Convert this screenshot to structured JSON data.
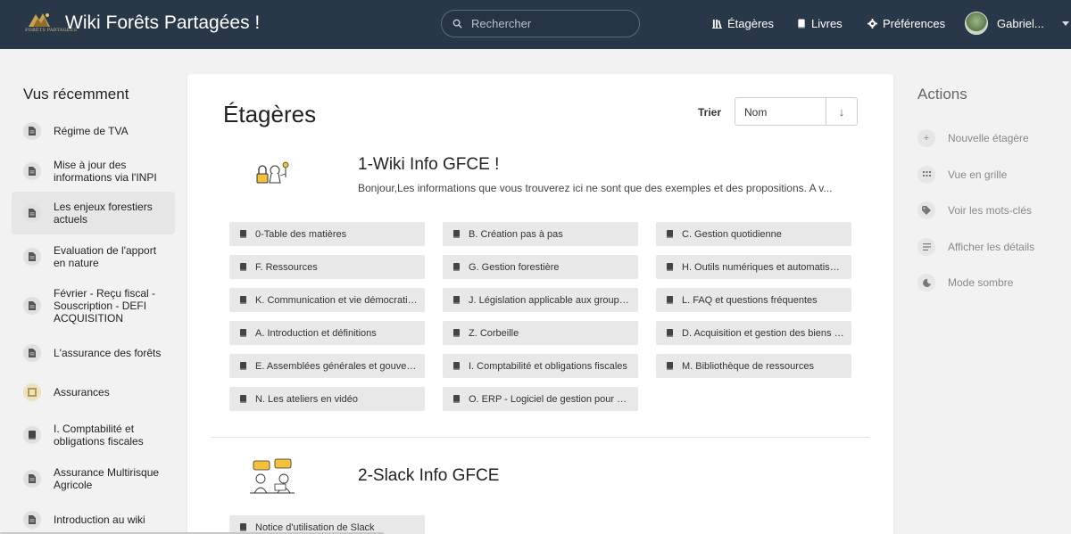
{
  "header": {
    "logo_text": "FORÊTS PARTAGÉES",
    "app_title": "Wiki Forêts Partagées !",
    "search_placeholder": "Rechercher",
    "nav": {
      "shelves": "Étagères",
      "books": "Livres",
      "preferences": "Préférences"
    },
    "user_name": "Gabriel..."
  },
  "recent": {
    "title": "Vus récemment",
    "items": [
      {
        "label": "Régime de TVA",
        "icon": "page-icon"
      },
      {
        "label": "Mise à jour des informations via l'INPI",
        "icon": "page-icon"
      },
      {
        "label": "Les enjeux forestiers actuels",
        "icon": "page-icon"
      },
      {
        "label": "Evaluation de l'apport en nature",
        "icon": "page-icon"
      },
      {
        "label": "Février - Reçu fiscal - Souscription - DEFI ACQUISITION",
        "icon": "page-icon"
      },
      {
        "label": "L'assurance des forêts",
        "icon": "page-icon"
      },
      {
        "label": "Assurances",
        "icon": "shelf-icon"
      },
      {
        "label": "I. Comptabilité et obligations fiscales",
        "icon": "book-icon"
      },
      {
        "label": "Assurance Multirisque Agricole",
        "icon": "page-icon"
      },
      {
        "label": "Introduction au wiki",
        "icon": "page-icon"
      }
    ]
  },
  "main": {
    "title": "Étagères",
    "sort_label": "Trier",
    "sort_value": "Nom",
    "sort_direction": "↓",
    "shelves": [
      {
        "name": "1-Wiki Info GFCE !",
        "description": "Bonjour,Les informations que vous trouverez ici ne sont que des exemples et des propositions. A v...",
        "books": [
          "0-Table des matières",
          "B. Création pas à pas",
          "C. Gestion quotidienne",
          "F. Ressources",
          "G. Gestion forestière",
          "H. Outils numériques et automatisations",
          "K. Communication et vie démocratique",
          "J. Législation applicable aux groupements",
          "L. FAQ et questions fréquentes",
          "A. Introduction et définitions",
          "Z. Corbeille",
          "D. Acquisition et gestion des biens fonciers",
          "E. Assemblées générales et gouvernance",
          "I. Comptabilité et obligations fiscales",
          "M. Bibliothèque de ressources",
          "N. Les ateliers en vidéo",
          "O. ERP - Logiciel de gestion pour GFCE"
        ]
      },
      {
        "name": "2-Slack Info GFCE",
        "description": "",
        "books": [
          "Notice d'utilisation de Slack"
        ]
      }
    ]
  },
  "actions": {
    "title": "Actions",
    "items": [
      {
        "label": "Nouvelle étagère",
        "icon": "plus-icon"
      },
      {
        "label": "Vue en grille",
        "icon": "grid-icon"
      },
      {
        "label": "Voir les mots-clés",
        "icon": "tag-icon"
      },
      {
        "label": "Afficher les détails",
        "icon": "list-icon"
      },
      {
        "label": "Mode sombre",
        "icon": "moon-icon"
      }
    ]
  },
  "colors": {
    "header_bg": "#283848",
    "page_bg": "#f2f2f2",
    "book_chip_bg": "#e8e8e8"
  }
}
